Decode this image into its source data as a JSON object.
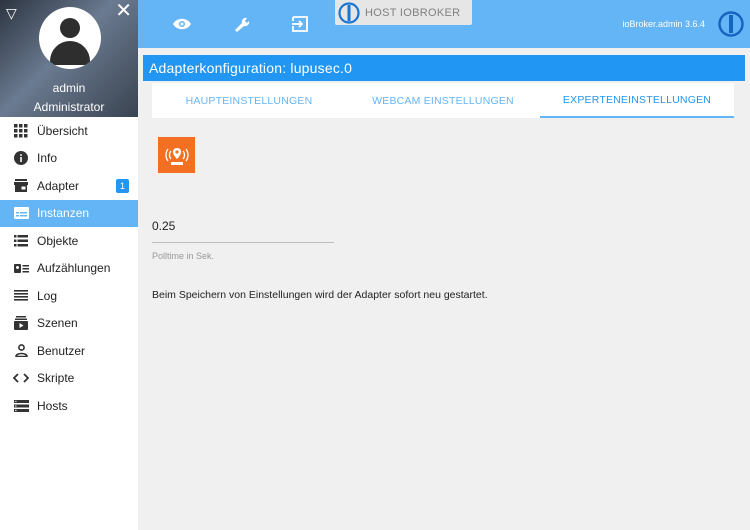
{
  "sidebar": {
    "user": {
      "name": "admin",
      "role": "Administrator"
    },
    "items": [
      {
        "label": "Übersicht",
        "icon": "apps-grid-icon"
      },
      {
        "label": "Info",
        "icon": "info-icon"
      },
      {
        "label": "Adapter",
        "icon": "store-icon",
        "badge": "1"
      },
      {
        "label": "Instanzen",
        "icon": "instances-icon"
      },
      {
        "label": "Objekte",
        "icon": "list-icon"
      },
      {
        "label": "Aufzählungen",
        "icon": "enums-icon"
      },
      {
        "label": "Log",
        "icon": "log-icon"
      },
      {
        "label": "Szenen",
        "icon": "scenes-icon"
      },
      {
        "label": "Benutzer",
        "icon": "user-icon"
      },
      {
        "label": "Skripte",
        "icon": "code-icon"
      },
      {
        "label": "Hosts",
        "icon": "hosts-icon"
      }
    ],
    "active_index": 3
  },
  "topbar": {
    "host_label": "HOST IOBROKER",
    "version": "ioBroker.admin 3.6.4"
  },
  "page": {
    "title": "Adapterkonfiguration: lupusec.0",
    "tabs": [
      "HAUPTEINSTELLUNGEN",
      "WEBCAM EINSTELLUNGEN",
      "EXPERTENEINSTELLUNGEN"
    ],
    "active_tab": 2
  },
  "settings": {
    "polltime_value": "0.25",
    "polltime_label": "Polltime in Sek.",
    "restart_notice": "Beim Speichern von Einstellungen wird der Adapter sofort neu gestartet."
  },
  "colors": {
    "accent": "#2196f3",
    "accent_light": "#64b5f6",
    "adapter_logo": "#f36f21"
  }
}
